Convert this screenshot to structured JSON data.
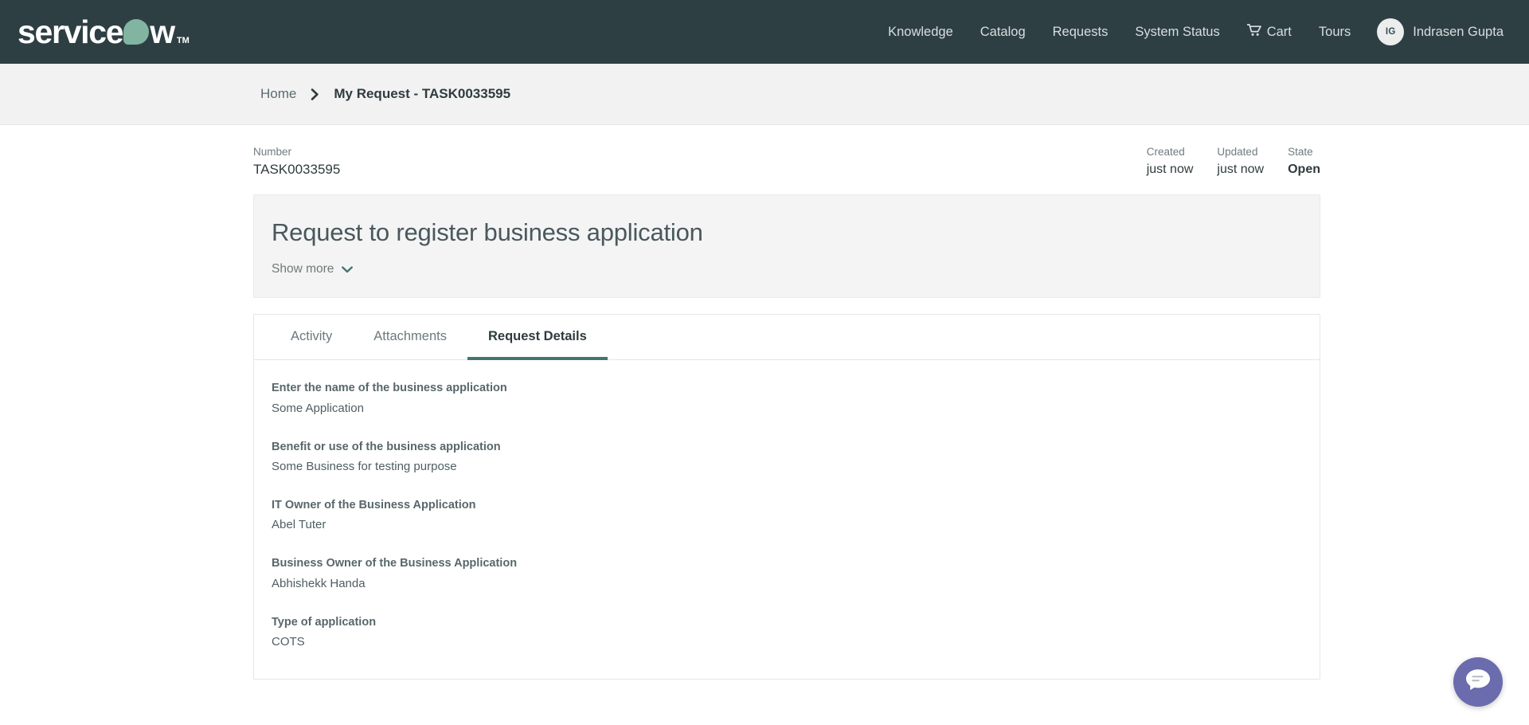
{
  "brand": {
    "logo_part1": "service",
    "logo_o": "o",
    "logo_part2": "w",
    "logo_tm": "TM",
    "accent_green": "#81b5a1",
    "header_bg": "#2e3f44",
    "tab_accent": "#44756e",
    "chat_purple": "#6b6cad"
  },
  "topnav": {
    "items": [
      {
        "label": "Knowledge"
      },
      {
        "label": "Catalog"
      },
      {
        "label": "Requests"
      },
      {
        "label": "System Status"
      }
    ],
    "cart_label": "Cart",
    "tours_label": "Tours",
    "user": {
      "initials": "IG",
      "name": "Indrasen Gupta"
    }
  },
  "breadcrumb": {
    "home": "Home",
    "separator": "›",
    "current": "My Request - TASK0033595"
  },
  "record": {
    "number_label": "Number",
    "number_value": "TASK0033595",
    "created_label": "Created",
    "created_value": "just now",
    "updated_label": "Updated",
    "updated_value": "just now",
    "state_label": "State",
    "state_value": "Open"
  },
  "title_card": {
    "title": "Request to register business application",
    "show_more": "Show more"
  },
  "tabs": [
    {
      "label": "Activity",
      "active": false
    },
    {
      "label": "Attachments",
      "active": false
    },
    {
      "label": "Request Details",
      "active": true
    }
  ],
  "request_details": [
    {
      "label": "Enter the name of the business application",
      "value": "Some Application"
    },
    {
      "label": "Benefit or use of the business application",
      "value": "Some Business for testing purpose"
    },
    {
      "label": "IT Owner of the Business Application",
      "value": "Abel Tuter"
    },
    {
      "label": "Business Owner of the Business Application",
      "value": "Abhishekk Handa"
    },
    {
      "label": "Type of application",
      "value": "COTS"
    }
  ]
}
